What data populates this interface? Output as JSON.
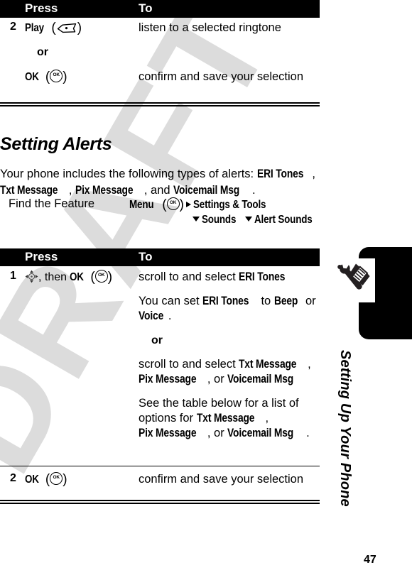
{
  "document": {
    "watermark": "DRAFT",
    "page_number": "47",
    "sidebar_title": "Setting Up Your Phone",
    "sidebar_icon": "wrench-screwdriver-icon"
  },
  "table_top": {
    "headers": {
      "press": "Press",
      "to": "To"
    },
    "rows": [
      {
        "num": "2",
        "press_primary": "Play",
        "press_primary_key": "softkey-icon",
        "or_label": "or",
        "press_secondary": "OK",
        "press_secondary_key": "ok-key-icon",
        "to_primary": "listen to a selected ringtone",
        "to_secondary": "confirm and save your selection"
      }
    ]
  },
  "section": {
    "heading": "Setting Alerts",
    "intro_prefix": "Your phone includes the following types of alerts: ",
    "intro_alert_1": "ERI Tones",
    "intro_sep_1": ", ",
    "intro_alert_2": "Txt Message",
    "intro_sep_2": ", ",
    "intro_alert_3": "Pix Message",
    "intro_sep_3": ", and ",
    "intro_alert_4": "Voicemail Msg",
    "intro_suffix": "."
  },
  "find_the_feature": {
    "label": "Find the Feature",
    "menu_label": "Menu",
    "menu_key": "ok-key-icon",
    "arrow_right": "triangle-right-icon",
    "path_1": "Settings & Tools",
    "arrow_down_1": "triangle-down-icon",
    "path_2": "Sounds",
    "arrow_down_2": "triangle-down-icon",
    "path_3": "Alert Sounds"
  },
  "table_main": {
    "headers": {
      "press": "Press",
      "to": "To"
    },
    "rows": [
      {
        "num": "1",
        "press_nav_key": "nav-pad-icon",
        "press_then": ", then ",
        "press_ok": "OK",
        "press_ok_key": "ok-key-icon",
        "to_p1_prefix": "scroll to and select ",
        "to_p1_term": "ERI Tones",
        "to_p2_a": "You can set ",
        "to_p2_term1": "ERI Tones",
        "to_p2_b": " to ",
        "to_p2_term2": "Beep",
        "to_p2_c": " or ",
        "to_p2_term3": "Voice",
        "to_p2_d": ".",
        "or_label": "or",
        "to_p3_prefix": "scroll to and select ",
        "to_p3_term1": "Txt Message",
        "to_p3_sep1": ", ",
        "to_p3_term2": "Pix Message",
        "to_p3_sep2": ", or ",
        "to_p3_term3": "Voicemail Msg",
        "to_p4_a": "See the table below for a list of options for ",
        "to_p4_term1": "Txt Message",
        "to_p4_sep1": ", ",
        "to_p4_term2": "Pix Message",
        "to_p4_sep2": ", or ",
        "to_p4_term3": "Voicemail Msg",
        "to_p4_end": "."
      },
      {
        "num": "2",
        "press_ok": "OK",
        "press_ok_key": "ok-key-icon",
        "to_primary": "confirm and save your selection"
      }
    ]
  },
  "colors": {
    "header_bg": "#000000",
    "header_text": "#ffffff",
    "watermark": "#dcdcdc",
    "rule": "#000000"
  }
}
